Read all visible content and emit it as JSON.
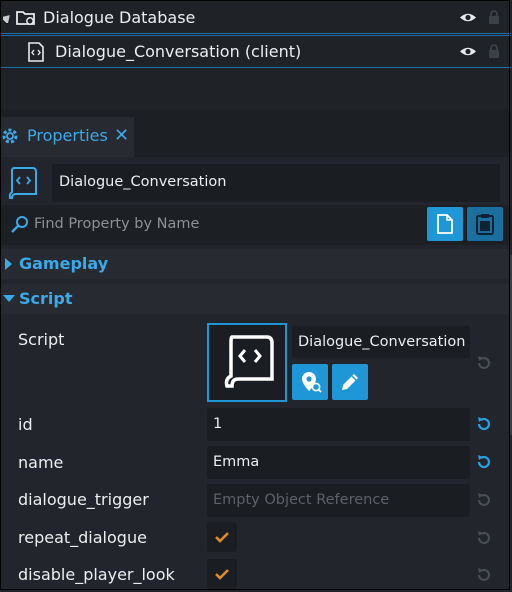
{
  "hierarchy": {
    "items": [
      {
        "label": "Dialogue Database"
      },
      {
        "label": "Dialogue_Conversation (client)"
      }
    ]
  },
  "properties_panel": {
    "tab_label": "Properties",
    "close_glyph": "✕",
    "object_name": "Dialogue_Conversation",
    "search_placeholder": "Find Property by Name",
    "sections": {
      "gameplay": "Gameplay",
      "script": "Script"
    },
    "props": {
      "script_label": "Script",
      "script_value": "Dialogue_Conversation",
      "id_label": "id",
      "id_value": "1",
      "name_label": "name",
      "name_value": "Emma",
      "trigger_label": "dialogue_trigger",
      "trigger_placeholder": "Empty Object Reference",
      "repeat_label": "repeat_dialogue",
      "repeat_checked": true,
      "disable_look_label": "disable_player_look",
      "disable_look_checked": true
    }
  },
  "colors": {
    "accent": "#3ba9e8",
    "button_blue": "#1f97d6",
    "check_orange": "#e08a2a",
    "reset_active": "#2a9fe0",
    "reset_inactive": "#4a4e55"
  },
  "icons": [
    "folder-link-icon",
    "script-file-icon",
    "eye-icon",
    "lock-icon",
    "gear-icon",
    "search-icon",
    "copy-icon",
    "paste-icon",
    "find-script-icon",
    "edit-pencil-icon",
    "reset-icon",
    "checkmark-icon"
  ]
}
